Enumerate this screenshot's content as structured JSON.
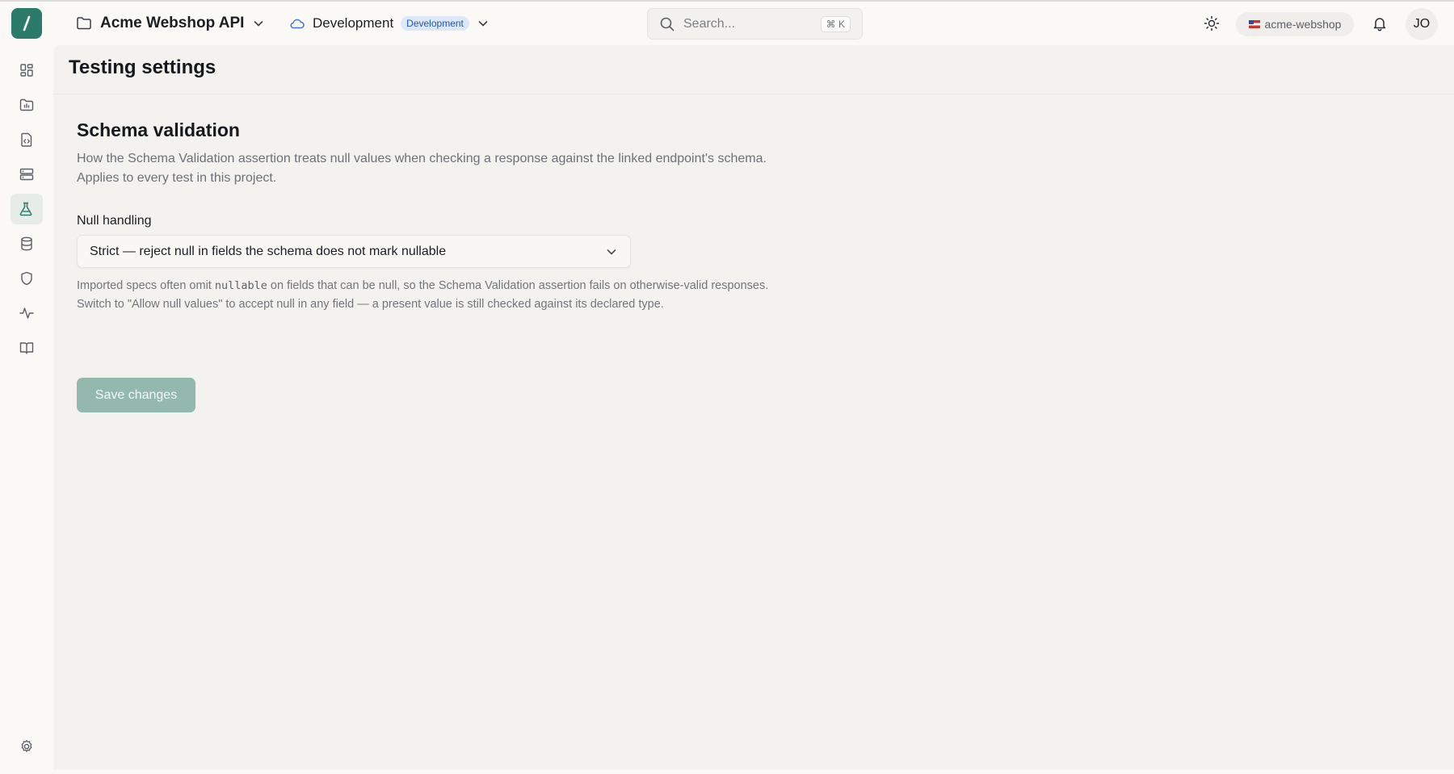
{
  "header": {
    "project_name": "Acme Webshop API",
    "environment_name": "Development",
    "environment_badge": "Development",
    "search_placeholder": "Search...",
    "search_shortcut": "⌘ K",
    "org_name": "acme-webshop",
    "avatar_initials": "JO"
  },
  "sidebar": {
    "items": [
      {
        "icon": "dashboard-icon"
      },
      {
        "icon": "folder-chart-icon"
      },
      {
        "icon": "file-code-icon"
      },
      {
        "icon": "server-icon"
      },
      {
        "icon": "flask-icon",
        "active": true
      },
      {
        "icon": "database-icon"
      },
      {
        "icon": "shield-icon"
      },
      {
        "icon": "activity-icon"
      },
      {
        "icon": "book-icon"
      }
    ],
    "bottom_icon": "gear-icon"
  },
  "page": {
    "title": "Testing settings",
    "section_title": "Schema validation",
    "section_description": "How the Schema Validation assertion treats null values when checking a response against the linked endpoint's schema. Applies to every test in this project.",
    "field_label": "Null handling",
    "select_value": "Strict — reject null in fields the schema does not mark nullable",
    "help_before": "Imported specs often omit ",
    "help_code": "nullable",
    "help_after": " on fields that can be null, so the Schema Validation assertion fails on otherwise-valid responses. Switch to \"Allow null values\" to accept null in any field — a present value is still checked against its declared type.",
    "save_label": "Save changes"
  },
  "colors": {
    "brand": "#2c7a6a",
    "save_disabled": "#93b8ae",
    "badge_bg": "#dde8f8",
    "badge_text": "#1f56b3"
  }
}
